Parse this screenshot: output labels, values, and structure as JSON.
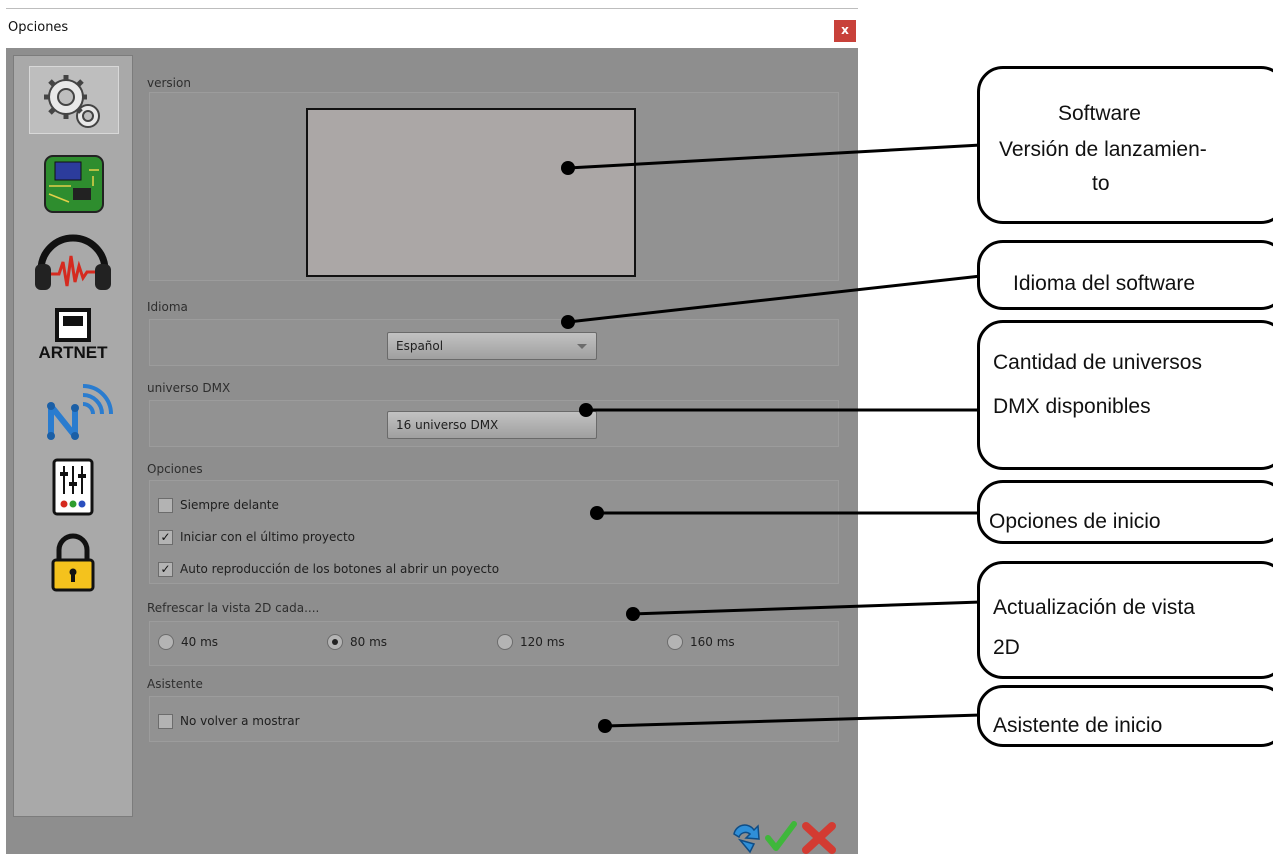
{
  "window": {
    "title": "Opciones",
    "close_label": "x"
  },
  "sidebar": {
    "items": [
      {
        "name": "settings",
        "active": true
      },
      {
        "name": "hardware",
        "active": false
      },
      {
        "name": "audio",
        "active": false
      },
      {
        "name": "artnet",
        "label": "ARTNET",
        "active": false
      },
      {
        "name": "network",
        "active": false
      },
      {
        "name": "mixer",
        "active": false
      },
      {
        "name": "lock",
        "active": false
      }
    ]
  },
  "sections": {
    "version": {
      "label": "version"
    },
    "idioma": {
      "label": "Idioma",
      "selected": "Español"
    },
    "universo": {
      "label": "universo DMX",
      "selected": "16 universo DMX"
    },
    "opciones": {
      "label": "Opciones",
      "items": [
        {
          "label": "Siempre delante",
          "checked": false
        },
        {
          "label": "Iniciar con el último proyecto",
          "checked": true
        },
        {
          "label": "Auto reproducción de los botones al abrir un poyecto",
          "checked": true
        }
      ]
    },
    "refresh": {
      "label": "Refrescar la vista 2D cada....",
      "options": [
        "40 ms",
        "80 ms",
        "120 ms",
        "160 ms"
      ],
      "selected": "80 ms"
    },
    "asistente": {
      "label": "Asistente",
      "items": [
        {
          "label": "No volver a mostrar",
          "checked": false
        }
      ]
    }
  },
  "footer": {
    "buttons": [
      "reset",
      "accept",
      "cancel"
    ]
  },
  "callouts": [
    {
      "id": "software",
      "lines": [
        "Software",
        "Versión de lanzamien-",
        "to"
      ]
    },
    {
      "id": "idioma",
      "lines": [
        "Idioma del software"
      ]
    },
    {
      "id": "universos",
      "lines": [
        "Cantidad de universos",
        "DMX disponibles"
      ]
    },
    {
      "id": "opciones",
      "lines": [
        "Opciones de inicio"
      ]
    },
    {
      "id": "refresco",
      "lines": [
        "Actualización de vista",
        "2D"
      ]
    },
    {
      "id": "asistente",
      "lines": [
        "Asistente de inicio"
      ]
    }
  ],
  "colors": {
    "dialog_bg": "#8e8e8e",
    "close_button": "#c8413a",
    "accent_check": "#3fb73b",
    "accent_cross": "#d33b32",
    "accent_reset": "#2f8fd8"
  }
}
